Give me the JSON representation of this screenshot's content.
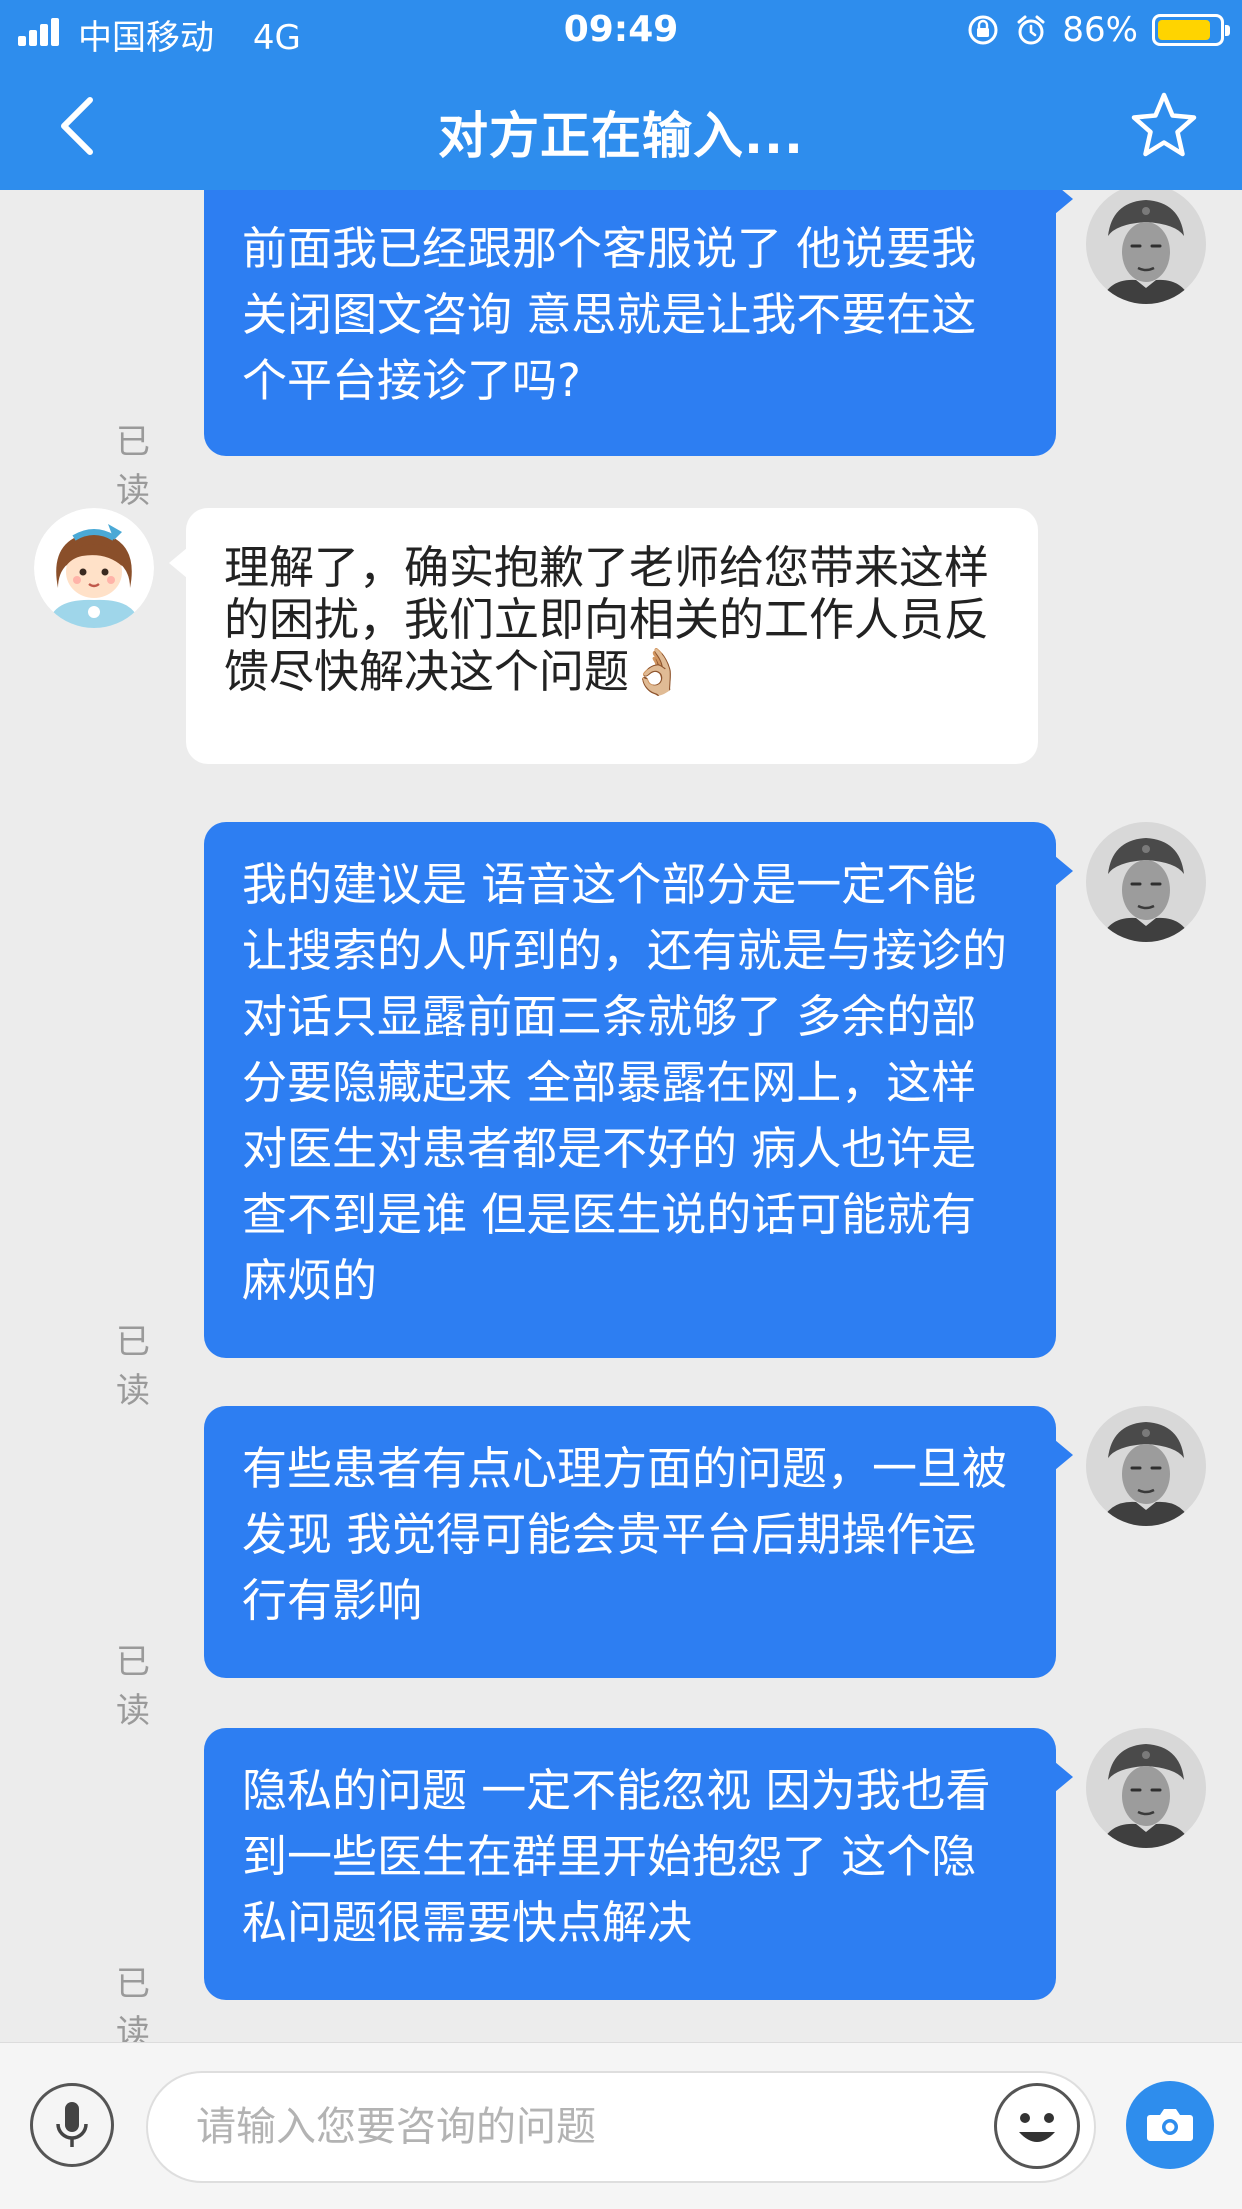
{
  "status_bar": {
    "carrier": "中国移动",
    "network": "4G",
    "time": "09:49",
    "battery_percent": "86%",
    "battery_level": 0.86,
    "icons": [
      "signal-bars-icon",
      "rotation-lock-icon",
      "alarm-icon",
      "battery-icon"
    ]
  },
  "header": {
    "title": "对方正在输入...",
    "back_icon": "chevron-left-icon",
    "favorite_icon": "star-outline-icon"
  },
  "colors": {
    "accent": "#2e8ded",
    "outgoing_bubble": "#2d7ef2",
    "incoming_bubble": "#ffffff",
    "chat_background": "#ececec",
    "battery_fill": "#ffd400"
  },
  "messages": [
    {
      "direction": "outgoing",
      "text": "前面我已经跟那个客服说了 他说要我关闭图文咨询 意思就是让我不要在这个平台接诊了吗?",
      "status": "已读",
      "avatar": "doctor-avatar"
    },
    {
      "direction": "incoming",
      "text": "理解了，确实抱歉了老师给您带来这样的困扰，我们立即向相关的工作人员反馈尽快解决这个问题",
      "emoji": "👌🏼",
      "avatar": "support-agent-avatar"
    },
    {
      "direction": "outgoing",
      "text": "我的建议是 语音这个部分是一定不能让搜索的人听到的，还有就是与接诊的对话只显露前面三条就够了 多余的部分要隐藏起来 全部暴露在网上，这样对医生对患者都是不好的 病人也许是查不到是谁 但是医生说的话可能就有麻烦的",
      "status": "已读",
      "avatar": "doctor-avatar"
    },
    {
      "direction": "outgoing",
      "text": "有些患者有点心理方面的问题，一旦被发现 我觉得可能会贵平台后期操作运行有影响",
      "status": "已读",
      "avatar": "doctor-avatar"
    },
    {
      "direction": "outgoing",
      "text": "隐私的问题 一定不能忽视 因为我也看到一些医生在群里开始抱怨了 这个隐私问题很需要快点解决",
      "status": "已读",
      "avatar": "doctor-avatar"
    }
  ],
  "input_bar": {
    "placeholder": "请输入您要咨询的问题",
    "value": "",
    "voice_icon": "microphone-icon",
    "emoji_icon": "smiley-face-icon",
    "camera_icon": "camera-icon"
  }
}
